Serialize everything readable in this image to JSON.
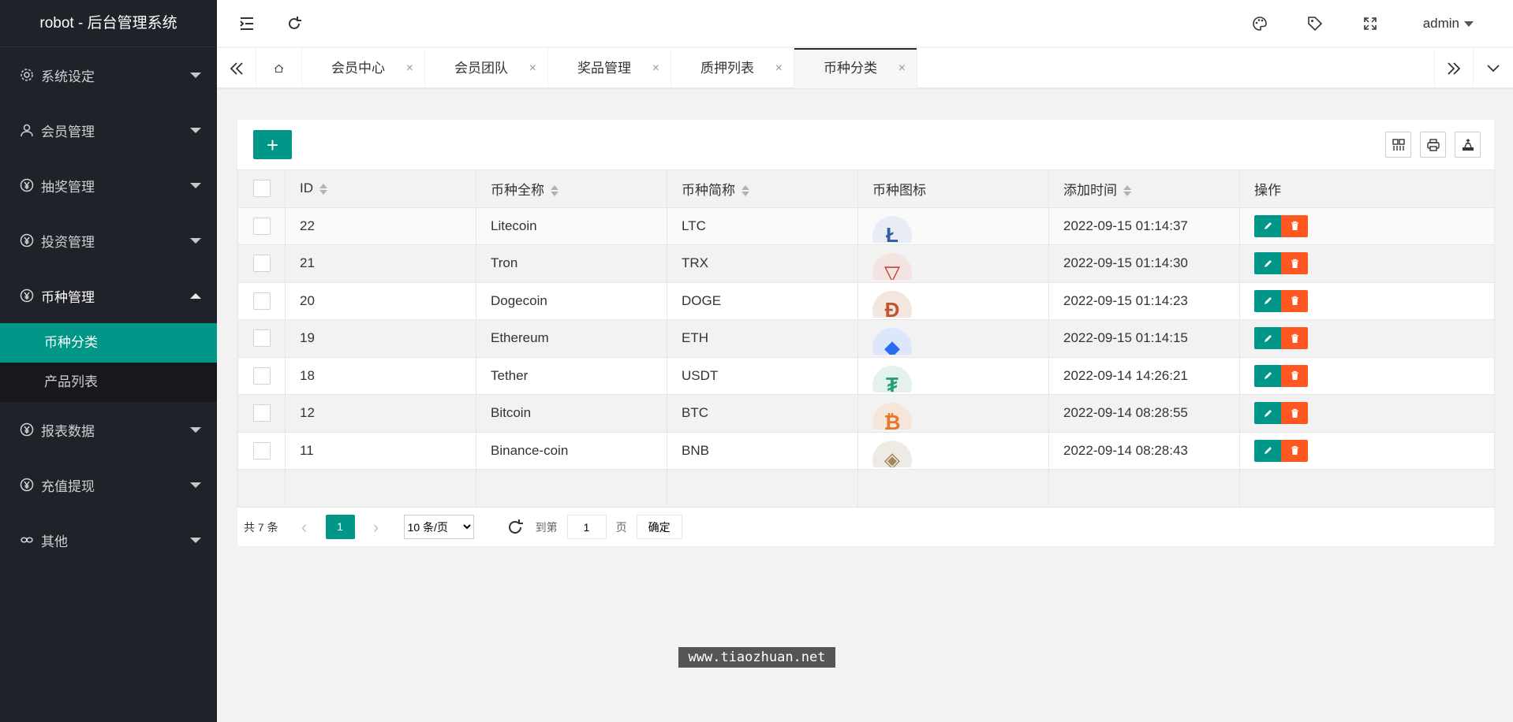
{
  "app_title": "robot - 后台管理系统",
  "sidebar": {
    "items": [
      {
        "label": "系统设定",
        "icon": "gear-icon"
      },
      {
        "label": "会员管理",
        "icon": "user-icon"
      },
      {
        "label": "抽奖管理",
        "icon": "yen-icon"
      },
      {
        "label": "投资管理",
        "icon": "yen-icon"
      },
      {
        "label": "币种管理",
        "icon": "yen-icon",
        "open": true
      },
      {
        "label": "报表数据",
        "icon": "yen-icon"
      },
      {
        "label": "充值提现",
        "icon": "yen-icon"
      },
      {
        "label": "其他",
        "icon": "link-icon"
      }
    ],
    "sub_items": [
      {
        "label": "币种分类",
        "active": true
      },
      {
        "label": "产品列表"
      }
    ]
  },
  "header": {
    "user": "admin",
    "icons": [
      "collapse-menu-icon",
      "refresh-icon",
      "palette-icon",
      "tag-icon",
      "fullscreen-icon"
    ]
  },
  "tabs": {
    "items": [
      {
        "label": "会员中心"
      },
      {
        "label": "会员团队"
      },
      {
        "label": "奖品管理"
      },
      {
        "label": "质押列表"
      },
      {
        "label": "币种分类",
        "active": true
      }
    ],
    "close_glyph": "×"
  },
  "toolbar": {
    "add_label": "+"
  },
  "table": {
    "columns": [
      "ID",
      "币种全称",
      "币种简称",
      "币种图标",
      "添加时间",
      "操作"
    ],
    "rows": [
      {
        "id": "22",
        "name": "Litecoin",
        "symbol": "LTC",
        "time": "2022-09-15 01:14:37",
        "icon_glyph": "Ł",
        "icon_color": "#345d9d",
        "icon_bg": "#e8ecf4"
      },
      {
        "id": "21",
        "name": "Tron",
        "symbol": "TRX",
        "time": "2022-09-15 01:14:30",
        "icon_glyph": "▽",
        "icon_color": "#c0392b",
        "icon_bg": "#f3e4e2"
      },
      {
        "id": "20",
        "name": "Dogecoin",
        "symbol": "DOGE",
        "time": "2022-09-15 01:14:23",
        "icon_glyph": "Đ",
        "icon_color": "#c0552f",
        "icon_bg": "#f3e6df"
      },
      {
        "id": "19",
        "name": "Ethereum",
        "symbol": "ETH",
        "time": "2022-09-15 01:14:15",
        "icon_glyph": "◆",
        "icon_color": "#2a6df4",
        "icon_bg": "#dde7fb"
      },
      {
        "id": "18",
        "name": "Tether",
        "symbol": "USDT",
        "time": "2022-09-14 14:26:21",
        "icon_glyph": "₮",
        "icon_color": "#26a17b",
        "icon_bg": "#e4f1ec"
      },
      {
        "id": "12",
        "name": "Bitcoin",
        "symbol": "BTC",
        "time": "2022-09-14 08:28:55",
        "icon_glyph": "₿",
        "icon_color": "#e8762c",
        "icon_bg": "#f5e6dc"
      },
      {
        "id": "11",
        "name": "Binance-coin",
        "symbol": "BNB",
        "time": "2022-09-14 08:28:43",
        "icon_glyph": "◈",
        "icon_color": "#a5865a",
        "icon_bg": "#eeebe5"
      }
    ]
  },
  "pager": {
    "total": "共 7 条",
    "current": "1",
    "page_size_options": [
      "10 条/页"
    ],
    "goto_label": "到第",
    "goto_value": "1",
    "page_label": "页",
    "confirm_label": "确定"
  },
  "watermark": "www.tiaozhuan.net",
  "colors": {
    "accent": "#009688",
    "danger": "#ff5722",
    "sidebar_bg": "#20222a"
  }
}
